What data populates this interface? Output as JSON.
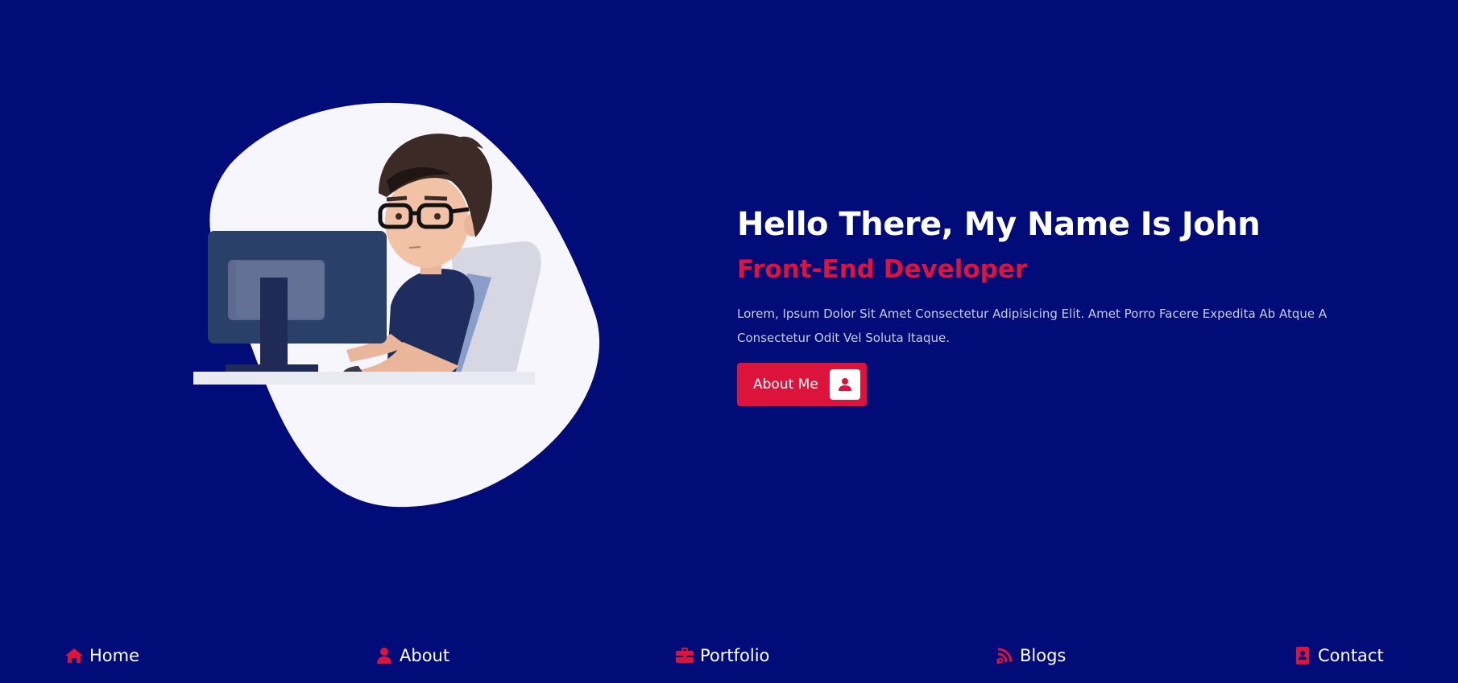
{
  "hero": {
    "title": "Hello There, My Name Is John",
    "subtitle": "Front-End Developer",
    "description": "Lorem, Ipsum Dolor Sit Amet Consectetur Adipisicing Elit. Amet Porro Facere Expedita Ab Atque A Consectetur Odit Vel Soluta Itaque.",
    "button_label": "About Me",
    "button_icon": "user-icon",
    "illustration": "developer-at-computer-illustration"
  },
  "nav": {
    "items": [
      {
        "label": "Home",
        "icon": "home-icon"
      },
      {
        "label": "About",
        "icon": "user-icon"
      },
      {
        "label": "Portfolio",
        "icon": "briefcase-icon"
      },
      {
        "label": "Blogs",
        "icon": "blog-icon"
      },
      {
        "label": "Contact",
        "icon": "address-book-icon"
      }
    ]
  },
  "colors": {
    "background": "#020c78",
    "accent": "#dc143c",
    "text_primary": "#ffffff",
    "text_muted": "#c8cbe6",
    "blob": "#f7f6fc"
  }
}
